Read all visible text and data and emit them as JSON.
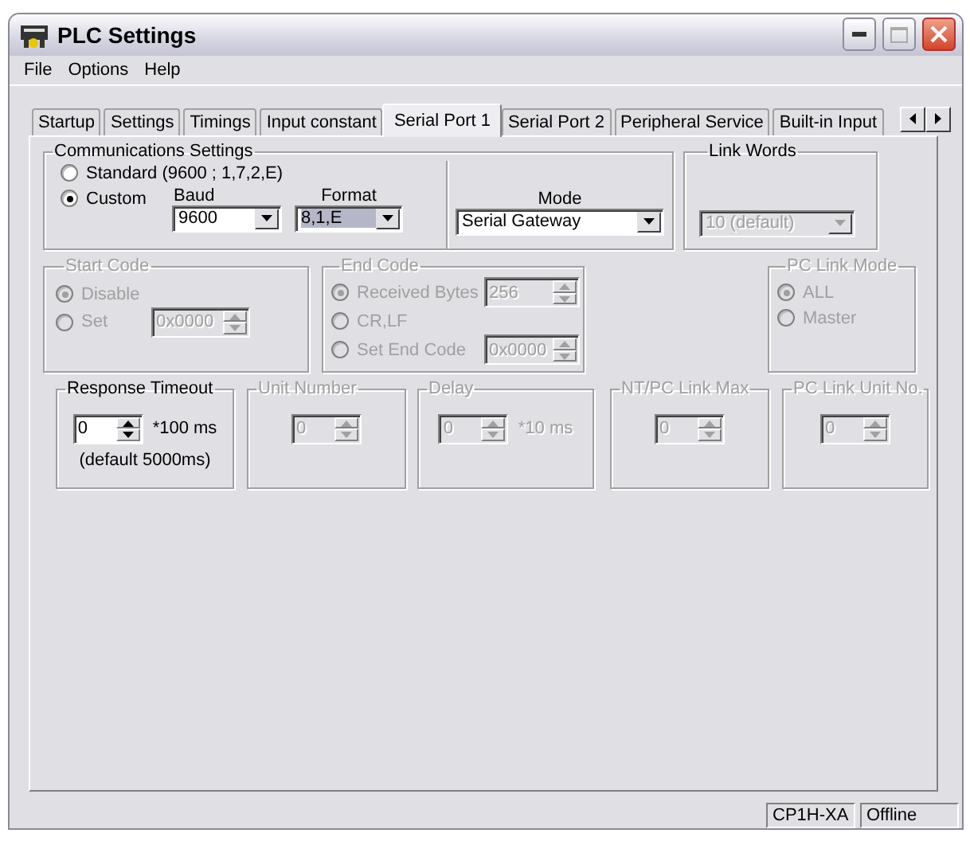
{
  "window": {
    "title": "PLC Settings"
  },
  "menu": [
    "File",
    "Options",
    "Help"
  ],
  "tabs": [
    {
      "label": "Startup",
      "selected": false
    },
    {
      "label": "Settings",
      "selected": false
    },
    {
      "label": "Timings",
      "selected": false
    },
    {
      "label": "Input constant",
      "selected": false
    },
    {
      "label": "Serial Port 1",
      "selected": true
    },
    {
      "label": "Serial Port 2",
      "selected": false
    },
    {
      "label": "Peripheral Service",
      "selected": false
    },
    {
      "label": "Built-in Input",
      "selected": false
    }
  ],
  "communications": {
    "title": "Communications Settings",
    "options": [
      {
        "label": "Standard (9600 ; 1,7,2,E)",
        "selected": false
      },
      {
        "label": "Custom",
        "selected": true
      }
    ],
    "baud": {
      "label": "Baud",
      "value": "9600",
      "focused": false
    },
    "format": {
      "label": "Format",
      "value": "8,1,E",
      "focused": true
    },
    "mode": {
      "label": "Mode",
      "value": "Serial Gateway"
    }
  },
  "link_words": {
    "title": "Link Words",
    "value": "10 (default)",
    "disabled": true
  },
  "start_code": {
    "title": "Start Code",
    "disabled": true,
    "options": [
      {
        "label": "Disable",
        "selected": true
      },
      {
        "label": "Set",
        "selected": false
      }
    ],
    "value": "0x0000"
  },
  "end_code": {
    "title": "End Code",
    "disabled": true,
    "options": [
      {
        "label": "Received Bytes",
        "selected": true,
        "value": "256"
      },
      {
        "label": "CR,LF",
        "selected": false
      },
      {
        "label": "Set End Code",
        "selected": false,
        "value": "0x0000"
      }
    ]
  },
  "pc_link_mode": {
    "title": "PC Link Mode",
    "disabled": true,
    "options": [
      {
        "label": "ALL",
        "selected": true
      },
      {
        "label": "Master",
        "selected": false
      }
    ]
  },
  "settings": [
    {
      "title": "Response Timeout",
      "value": "0",
      "disabled": false,
      "unit": "*100 ms",
      "note": "(default 5000ms)"
    },
    {
      "title": "Unit Number",
      "value": "0",
      "disabled": true
    },
    {
      "title": "Delay",
      "value": "0",
      "disabled": true,
      "unit": "*10 ms"
    },
    {
      "title": "NT/PC Link Max",
      "value": "0",
      "disabled": true
    },
    {
      "title": "PC Link Unit No.",
      "value": "0",
      "disabled": true
    }
  ],
  "status_bar": [
    "CP1H-XA",
    "Offline"
  ]
}
